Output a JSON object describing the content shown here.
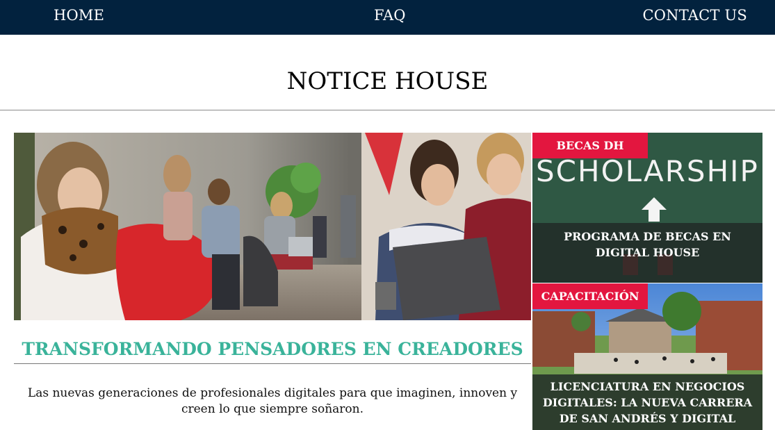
{
  "nav": {
    "home": "HOME",
    "faq": "FAQ",
    "contact": "CONTACT US"
  },
  "site": {
    "title": "NOTICE HOUSE"
  },
  "feature": {
    "title": "TRANSFORMANDO PENSADORES EN CREADORES",
    "text": "Las nuevas generaciones de profesionales digitales para que imaginen, innoven y creen lo que siempre soñaron.",
    "image_icon": "students-photo"
  },
  "cards": [
    {
      "badge": "BECAS DH",
      "board_text": "SCHOLARSHIP",
      "title": "PROGRAMA DE BECAS EN DIGITAL HOUSE",
      "image_icon": "scholarship-chalkboard-photo"
    },
    {
      "badge": "CAPACITACIÓN",
      "title": "LICENCIATURA EN NEGOCIOS DIGITALES: LA NUEVA CARRERA DE SAN ANDRÉS Y DIGITAL HOUSE",
      "image_icon": "campus-photo"
    }
  ],
  "colors": {
    "nav_bg": "#02223e",
    "accent_teal": "#3ab39a",
    "badge_red": "#e3163f"
  }
}
